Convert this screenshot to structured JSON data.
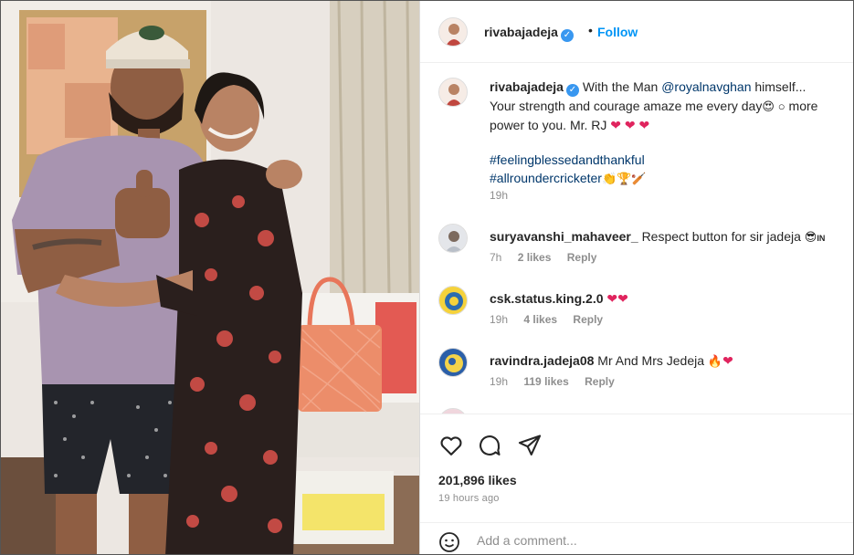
{
  "post": {
    "username": "rivabajadeja",
    "follow_label": "Follow",
    "dot": "•",
    "caption": {
      "username": "rivabajadeja",
      "text_1": "With the Man",
      "mention": "@royalnavghan",
      "text_2": "himself...",
      "text_3": "Your strength and courage amaze me every day",
      "text_4": "more",
      "text_5": "power to you. Mr. RJ",
      "hashtag_1": "#feelingblessedandthankful",
      "hashtag_2": "#allroundercricketer",
      "time": "19h"
    },
    "comments": [
      {
        "username": "suryavanshi_mahaveer_",
        "text": "Respect button for sir jadeja",
        "time": "7h",
        "likes": "2 likes",
        "reply": "Reply"
      },
      {
        "username": "csk.status.king.2.0",
        "text": "",
        "time": "19h",
        "likes": "4 likes",
        "reply": "Reply"
      },
      {
        "username": "ravindra.jadeja08",
        "text": "Mr And Mrs Jedeja",
        "time": "19h",
        "likes": "119 likes",
        "reply": "Reply"
      }
    ],
    "likes_count": "201,896 likes",
    "posted_ago": "19 hours ago",
    "add_comment_placeholder": "Add a comment..."
  },
  "icons": {
    "like": "heart-outline-icon",
    "comment": "comment-bubble-icon",
    "share": "paper-plane-icon",
    "emoji": "smiley-face-icon",
    "verified": "verified-badge-icon"
  },
  "colors": {
    "link_blue": "#0095f6",
    "verified_blue": "#3897f0",
    "heart_red": "#e0245e",
    "meta_gray": "#8e8e8e",
    "hashtag_navy": "#00376b"
  }
}
